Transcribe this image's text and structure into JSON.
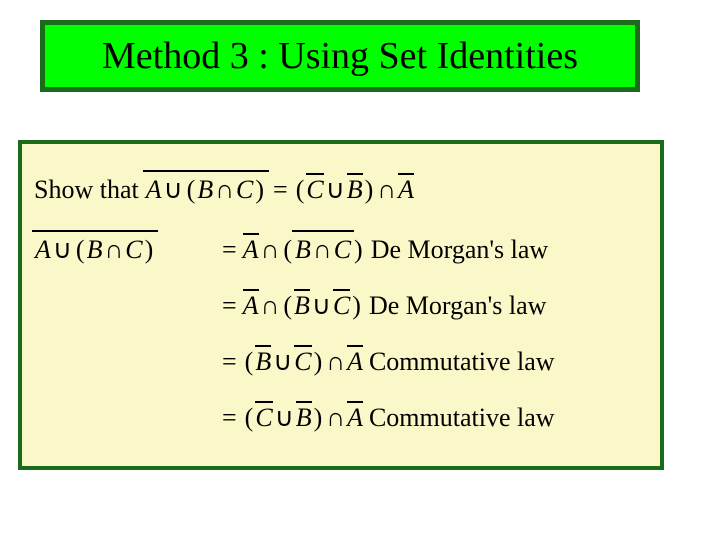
{
  "title": "Method 3 : Using Set Identities",
  "show_label": "Show that",
  "symbols": {
    "A": "A",
    "B": "B",
    "C": "C",
    "union": "∪",
    "intersect": "∩",
    "lparen": "(",
    "rparen": ")",
    "equals": "="
  },
  "justifications": {
    "demorgan": "De Morgan's law",
    "commutative": "Commutative law"
  }
}
